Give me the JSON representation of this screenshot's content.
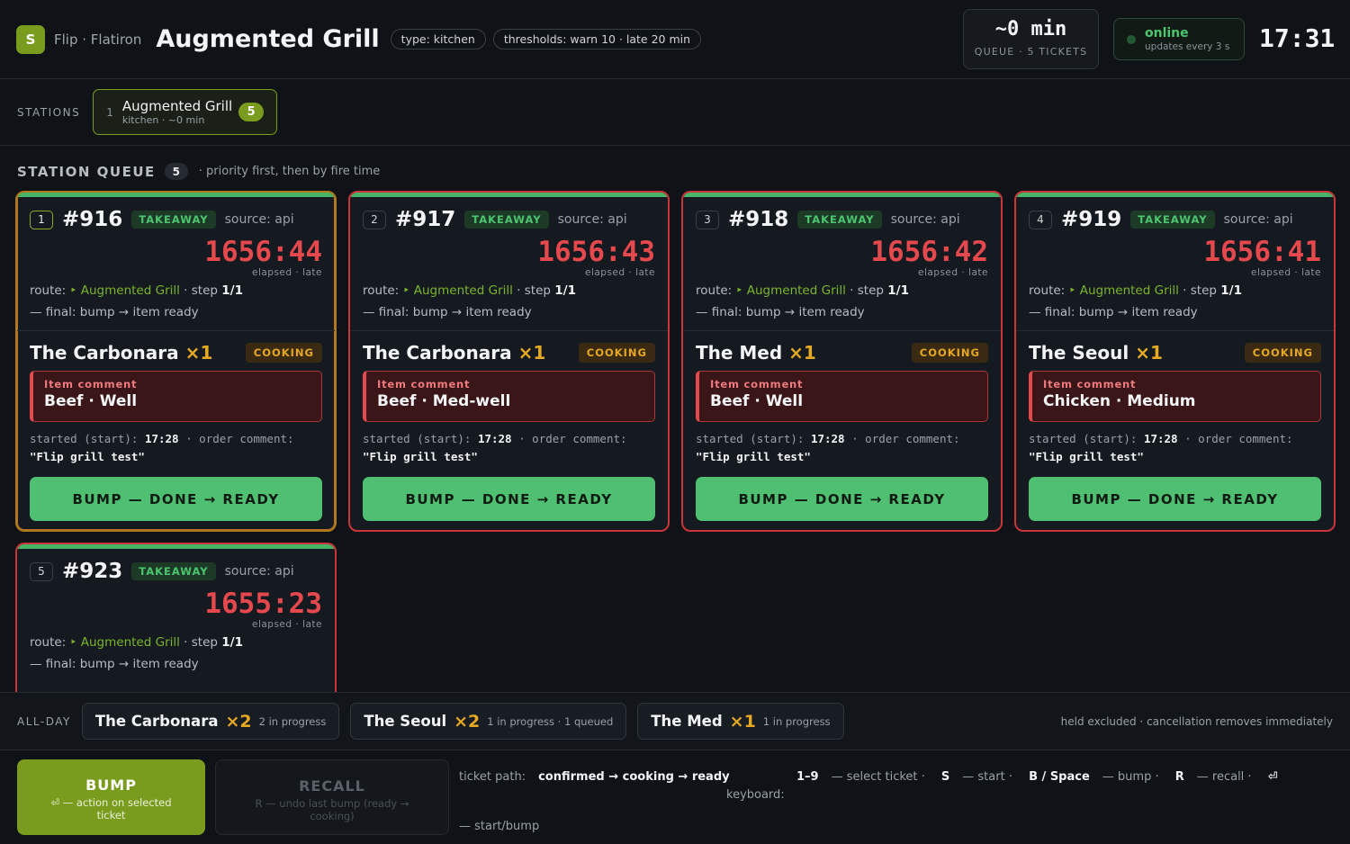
{
  "header": {
    "logo_letter": "S",
    "brand": "Flip · Flatiron",
    "station_name": "Augmented Grill",
    "type_chip": "type: kitchen",
    "thresholds_chip": "thresholds: warn 10 · late 20 min",
    "queue_value": "~0 min",
    "queue_label": "QUEUE · 5 TICKETS",
    "status": "online",
    "status_sub": "updates every 3 s",
    "clock": "17:31"
  },
  "stations": {
    "label": "STATIONS",
    "items": [
      {
        "index": "1",
        "name": "Augmented Grill",
        "sub": "kitchen · ~0 min",
        "count": "5"
      }
    ]
  },
  "queue": {
    "title": "STATION QUEUE",
    "count": "5",
    "note": "· priority first, then by fire time"
  },
  "tickets": [
    {
      "index": "1",
      "number": "#916",
      "tag": "TAKEAWAY",
      "source": "source: api",
      "elapsed": "1656:44",
      "elapsed_sub": "elapsed · late",
      "route_prefix": "route:",
      "route_station": "‣ Augmented Grill",
      "route_step_label": "· step",
      "route_step": "1/1",
      "final": "— final: bump → item ready",
      "item_name": "The Carbonara",
      "item_qty": "×1",
      "item_status": "COOKING",
      "comment_label": "Item comment",
      "comment_value": "Beef · Well",
      "started_prefix": "started (start):",
      "started_time": "17:28",
      "order_comment_label": "· order comment:",
      "order_comment": "\"Flip grill test\"",
      "bump_label": "BUMP — DONE → READY"
    },
    {
      "index": "2",
      "number": "#917",
      "tag": "TAKEAWAY",
      "source": "source: api",
      "elapsed": "1656:43",
      "elapsed_sub": "elapsed · late",
      "route_prefix": "route:",
      "route_station": "‣ Augmented Grill",
      "route_step_label": "· step",
      "route_step": "1/1",
      "final": "— final: bump → item ready",
      "item_name": "The Carbonara",
      "item_qty": "×1",
      "item_status": "COOKING",
      "comment_label": "Item comment",
      "comment_value": "Beef · Med-well",
      "started_prefix": "started (start):",
      "started_time": "17:28",
      "order_comment_label": "· order comment:",
      "order_comment": "\"Flip grill test\"",
      "bump_label": "BUMP — DONE → READY"
    },
    {
      "index": "3",
      "number": "#918",
      "tag": "TAKEAWAY",
      "source": "source: api",
      "elapsed": "1656:42",
      "elapsed_sub": "elapsed · late",
      "route_prefix": "route:",
      "route_station": "‣ Augmented Grill",
      "route_step_label": "· step",
      "route_step": "1/1",
      "final": "— final: bump → item ready",
      "item_name": "The Med",
      "item_qty": "×1",
      "item_status": "COOKING",
      "comment_label": "Item comment",
      "comment_value": "Beef · Well",
      "started_prefix": "started (start):",
      "started_time": "17:28",
      "order_comment_label": "· order comment:",
      "order_comment": "\"Flip grill test\"",
      "bump_label": "BUMP — DONE → READY"
    },
    {
      "index": "4",
      "number": "#919",
      "tag": "TAKEAWAY",
      "source": "source: api",
      "elapsed": "1656:41",
      "elapsed_sub": "elapsed · late",
      "route_prefix": "route:",
      "route_station": "‣ Augmented Grill",
      "route_step_label": "· step",
      "route_step": "1/1",
      "final": "— final: bump → item ready",
      "item_name": "The Seoul",
      "item_qty": "×1",
      "item_status": "COOKING",
      "comment_label": "Item comment",
      "comment_value": "Chicken · Medium",
      "started_prefix": "started (start):",
      "started_time": "17:28",
      "order_comment_label": "· order comment:",
      "order_comment": "\"Flip grill test\"",
      "bump_label": "BUMP — DONE → READY"
    },
    {
      "index": "5",
      "number": "#923",
      "tag": "TAKEAWAY",
      "source": "source: api",
      "elapsed": "1655:23",
      "elapsed_sub": "elapsed · late",
      "route_prefix": "route:",
      "route_station": "‣ Augmented Grill",
      "route_step_label": "· step",
      "route_step": "1/1",
      "final": "— final: bump → item ready"
    }
  ],
  "allday": {
    "label": "ALL-DAY",
    "items": [
      {
        "name": "The Carbonara",
        "qty": "×2",
        "status": "2 in progress"
      },
      {
        "name": "The Seoul",
        "qty": "×2",
        "status": "1 in progress · 1 queued"
      },
      {
        "name": "The Med",
        "qty": "×1",
        "status": "1 in progress"
      }
    ],
    "note": "held excluded · cancellation removes immediately"
  },
  "bottom": {
    "bump_title": "BUMP",
    "bump_sub": "⏎ — action on selected ticket",
    "recall_title": "RECALL",
    "recall_sub": "R — undo last bump (ready → cooking)",
    "path_label": "ticket path:",
    "path_value": "confirmed → cooking → ready",
    "path_tail": "— start/bump",
    "keyboard_label": "keyboard:",
    "keys": [
      {
        "key": "1–9",
        "desc": "— select ticket ·"
      },
      {
        "key": "S",
        "desc": "— start ·"
      },
      {
        "key": "B / Space",
        "desc": "— bump ·"
      },
      {
        "key": "R",
        "desc": "— recall ·"
      },
      {
        "key": "⏎",
        "desc": ""
      }
    ]
  },
  "colors": {
    "accent": "#7a9c1e",
    "late": "#e5484d",
    "ok": "#4fbf71",
    "cooking": "#e5a823"
  }
}
